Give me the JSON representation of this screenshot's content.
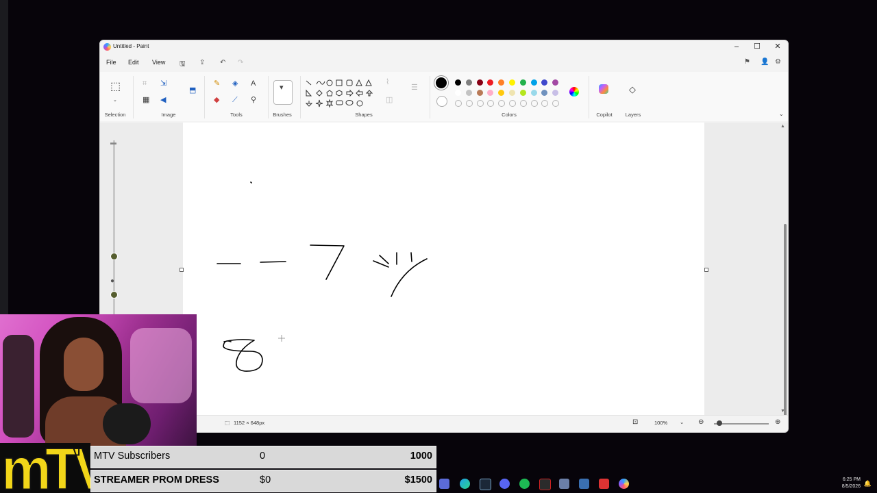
{
  "window": {
    "title": "Untitled - Paint"
  },
  "menu": {
    "file": "File",
    "edit": "Edit",
    "view": "View"
  },
  "ribbon": {
    "groups": {
      "selection": "Selection",
      "image": "Image",
      "tools": "Tools",
      "brushes": "Brushes",
      "shapes": "Shapes",
      "colors": "Colors",
      "copilot": "Copilot",
      "layers": "Layers"
    },
    "colors": {
      "row1": [
        "#000000",
        "#7f7f7f",
        "#880015",
        "#ed1c24",
        "#ff7f27",
        "#fff200",
        "#22b14c",
        "#00a2e8",
        "#3f48cc",
        "#a349a4"
      ],
      "row2": [
        "#ffffff",
        "#c3c3c3",
        "#b97a57",
        "#ffaec9",
        "#ffc90e",
        "#efe4b0",
        "#b5e61d",
        "#99d9ea",
        "#7092be",
        "#c8bfe7"
      ]
    }
  },
  "status": {
    "canvas_size": "1152 × 648px",
    "zoom": "100%"
  },
  "overlay": {
    "logo": "mTV",
    "goals": [
      {
        "label": "MTV Subscribers",
        "current": "0",
        "target": "1000"
      },
      {
        "label": "STREAMER PROM DRESS",
        "current": "$0",
        "target": "$1500"
      }
    ]
  },
  "clock": {
    "time": "6:25 PM",
    "date": "8/5/2026"
  }
}
